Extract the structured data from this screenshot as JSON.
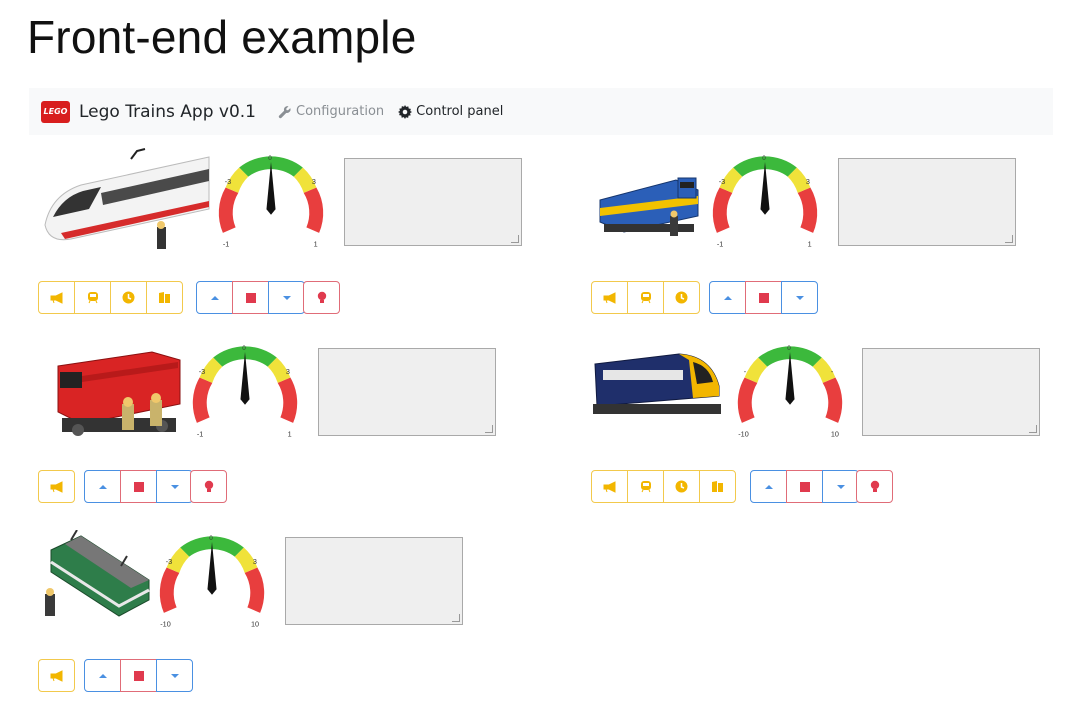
{
  "page": {
    "title": "Front-end example"
  },
  "navbar": {
    "brand_logo_text": "LEGO",
    "brand": "Lego Trains App v0.1",
    "links": [
      {
        "label": "Configuration",
        "icon": "wrench-icon",
        "active": false
      },
      {
        "label": "Control panel",
        "icon": "gear-icon",
        "active": true
      }
    ]
  },
  "colors": {
    "warning": "#f2c94c",
    "info": "#4a90e2",
    "danger": "#e06c78",
    "gauge_green": "#3cb93c",
    "gauge_yellow": "#f0e23a",
    "gauge_red": "#e83e3e"
  },
  "trains": [
    {
      "name": "passenger-train",
      "gauge_labels": [
        "-1",
        "-3",
        "0",
        "3",
        "1"
      ],
      "buttons": [
        "horn",
        "wagon",
        "clock",
        "door"
      ],
      "has_light": true
    },
    {
      "name": "blue-diesel",
      "gauge_labels": [
        "-1",
        "-3",
        "0",
        "3",
        "1"
      ],
      "buttons": [
        "horn",
        "wagon",
        "clock"
      ],
      "has_light": false
    },
    {
      "name": "red-cargo",
      "gauge_labels": [
        "-1",
        "-3",
        "0",
        "3",
        "1"
      ],
      "buttons": [
        "horn"
      ],
      "has_light": true
    },
    {
      "name": "yellow-passenger",
      "gauge_labels": [
        "-10",
        "-",
        "0",
        "-",
        "10"
      ],
      "buttons": [
        "horn",
        "wagon",
        "clock",
        "door"
      ],
      "has_light": true
    },
    {
      "name": "green-electric",
      "gauge_labels": [
        "-10",
        "-3",
        "0",
        "3",
        "10"
      ],
      "buttons": [
        "horn"
      ],
      "has_light": false
    }
  ]
}
